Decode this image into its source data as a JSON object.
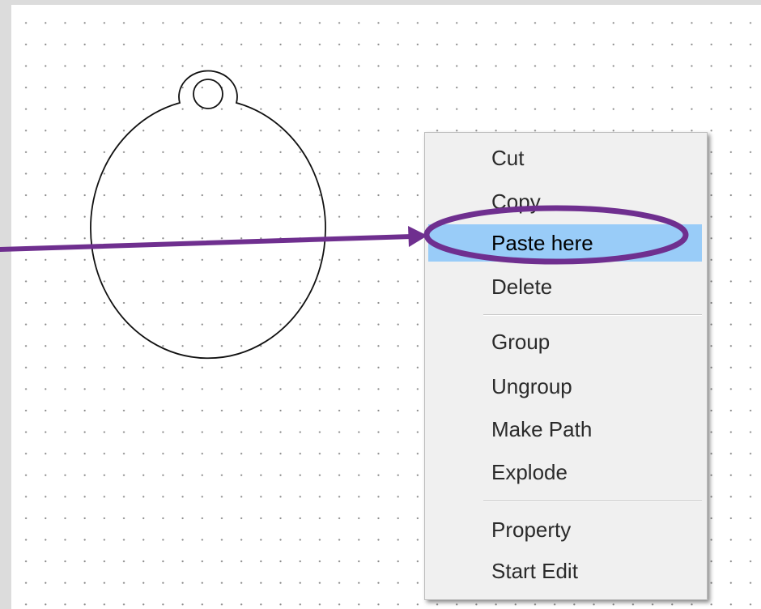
{
  "canvas": {
    "background": "#ffffff",
    "grid": "dotted",
    "shape": "pendant-tag-outline"
  },
  "context_menu": {
    "items": [
      {
        "label": "Cut",
        "state": "normal"
      },
      {
        "label": "Copy",
        "state": "normal"
      },
      {
        "label": "Paste here",
        "state": "highlighted"
      },
      {
        "label": "Delete",
        "state": "normal"
      },
      {
        "label": "Group",
        "state": "normal"
      },
      {
        "label": "Ungroup",
        "state": "normal"
      },
      {
        "label": "Make Path",
        "state": "normal"
      },
      {
        "label": "Explode",
        "state": "normal"
      },
      {
        "label": "Property",
        "state": "normal"
      },
      {
        "label": "Start Edit",
        "state": "normal"
      }
    ],
    "highlight_color": "#99ccf8"
  },
  "annotation": {
    "type": "arrow-with-ellipse",
    "target": "Paste here",
    "color": "#6f2f8f"
  }
}
